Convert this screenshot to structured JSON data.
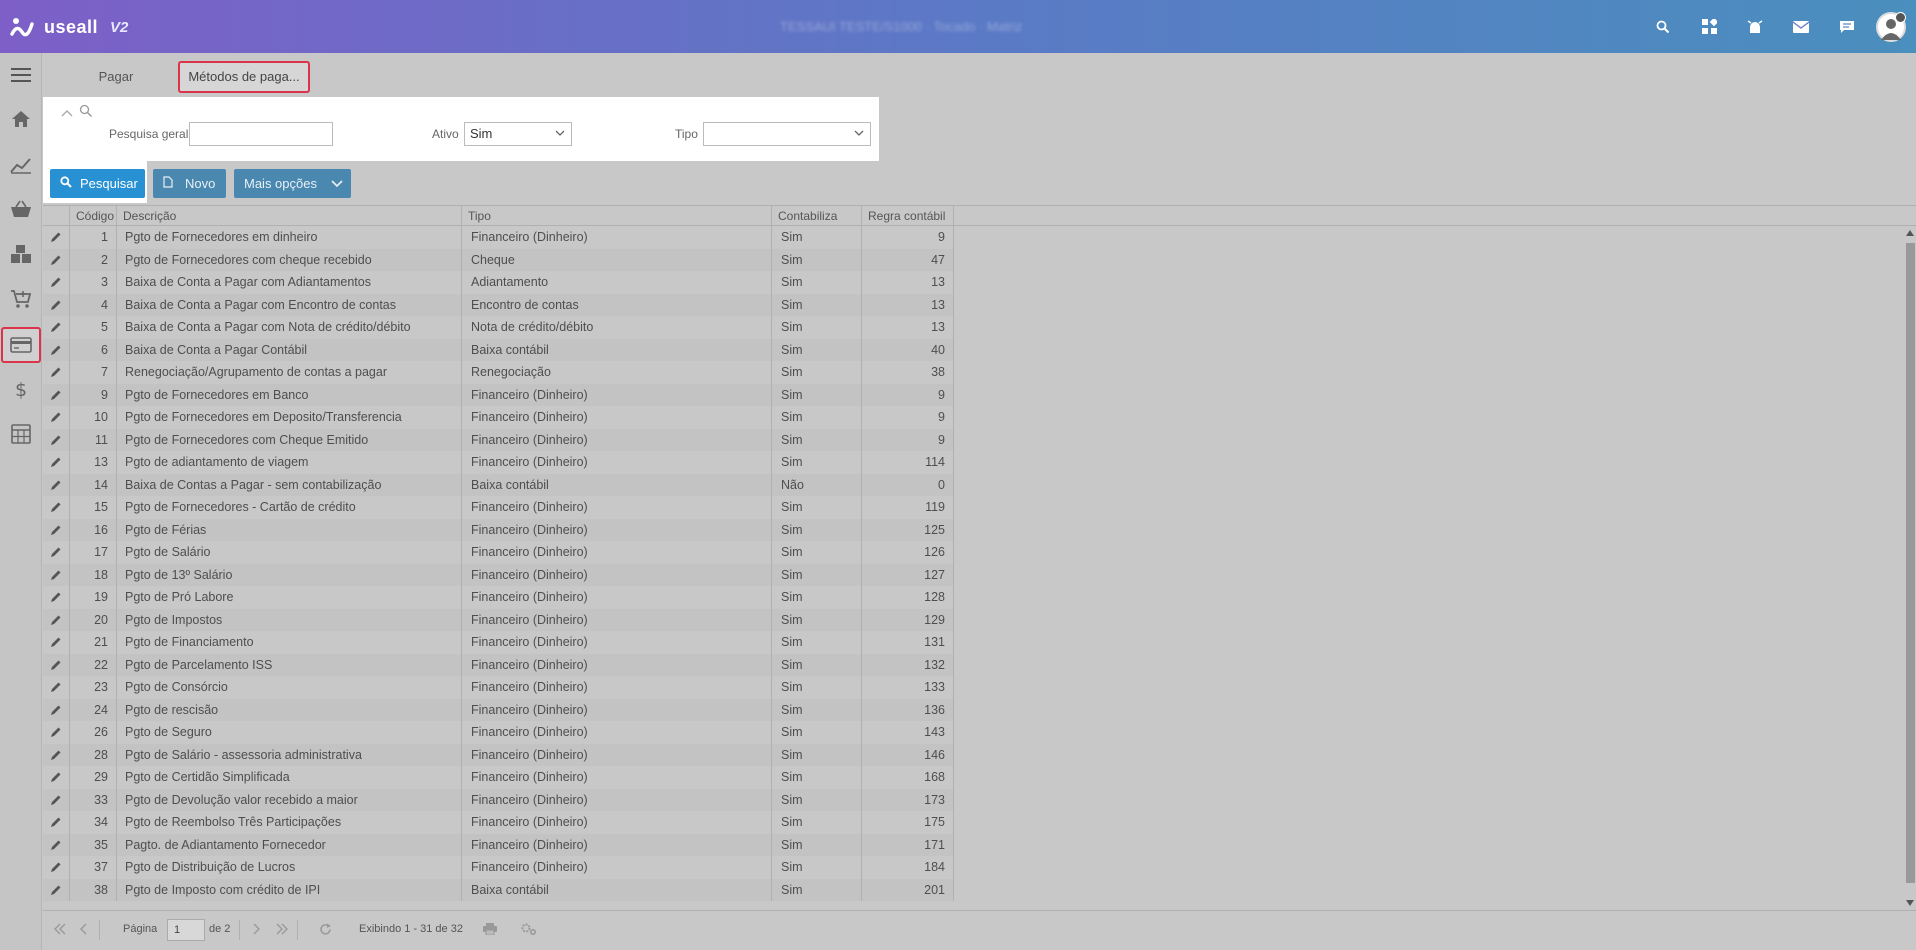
{
  "app": {
    "logo_text": "useall",
    "version": "V2",
    "center_text": "TESSAUI TESTE/S1000 · Tocado · Matriz"
  },
  "topbar_icons": [
    "search-icon",
    "apps-icon",
    "alarm-icon",
    "mail-icon",
    "chat-icon",
    "user-avatar"
  ],
  "sidebar_icons": [
    "menu-icon",
    "home-icon",
    "chart-icon",
    "basket-icon",
    "boxes-icon",
    "cart-icon",
    "payment-card-icon",
    "dollar-icon",
    "calculator-icon"
  ],
  "tabs": [
    {
      "label": "Pagar"
    },
    {
      "label": "Métodos de paga..."
    }
  ],
  "filter": {
    "general_label": "Pesquisa geral",
    "general_value": "",
    "ativo_label": "Ativo",
    "ativo_value": "Sim",
    "tipo_label": "Tipo",
    "tipo_value": ""
  },
  "actions": {
    "search_label": "Pesquisar",
    "new_label": "Novo",
    "more_label": "Mais opções"
  },
  "table": {
    "columns": [
      "Código",
      "Descrição",
      "Tipo",
      "Contabiliza",
      "Regra contábil"
    ],
    "rows": [
      {
        "code": "1",
        "desc": "Pgto de Fornecedores em dinheiro",
        "tipo": "Financeiro (Dinheiro)",
        "cont": "Sim",
        "regra": "9"
      },
      {
        "code": "2",
        "desc": "Pgto de Fornecedores com cheque recebido",
        "tipo": "Cheque",
        "cont": "Sim",
        "regra": "47"
      },
      {
        "code": "3",
        "desc": "Baixa de Conta a Pagar com Adiantamentos",
        "tipo": "Adiantamento",
        "cont": "Sim",
        "regra": "13"
      },
      {
        "code": "4",
        "desc": "Baixa de Conta a Pagar com Encontro de contas",
        "tipo": "Encontro de contas",
        "cont": "Sim",
        "regra": "13"
      },
      {
        "code": "5",
        "desc": "Baixa de Conta a Pagar com Nota de crédito/débito",
        "tipo": "Nota de crédito/débito",
        "cont": "Sim",
        "regra": "13"
      },
      {
        "code": "6",
        "desc": "Baixa de Conta a Pagar Contábil",
        "tipo": "Baixa contábil",
        "cont": "Sim",
        "regra": "40"
      },
      {
        "code": "7",
        "desc": "Renegociação/Agrupamento de contas a pagar",
        "tipo": "Renegociação",
        "cont": "Sim",
        "regra": "38"
      },
      {
        "code": "9",
        "desc": "Pgto de Fornecedores em Banco",
        "tipo": "Financeiro (Dinheiro)",
        "cont": "Sim",
        "regra": "9"
      },
      {
        "code": "10",
        "desc": "Pgto de Fornecedores em Deposito/Transferencia",
        "tipo": "Financeiro (Dinheiro)",
        "cont": "Sim",
        "regra": "9"
      },
      {
        "code": "11",
        "desc": "Pgto de Fornecedores com Cheque Emitido",
        "tipo": "Financeiro (Dinheiro)",
        "cont": "Sim",
        "regra": "9"
      },
      {
        "code": "13",
        "desc": "Pgto de adiantamento de viagem",
        "tipo": "Financeiro (Dinheiro)",
        "cont": "Sim",
        "regra": "114"
      },
      {
        "code": "14",
        "desc": "Baixa de Contas a Pagar - sem contabilização",
        "tipo": "Baixa contábil",
        "cont": "Não",
        "regra": "0"
      },
      {
        "code": "15",
        "desc": "Pgto de Fornecedores - Cartão de crédito",
        "tipo": "Financeiro (Dinheiro)",
        "cont": "Sim",
        "regra": "119"
      },
      {
        "code": "16",
        "desc": "Pgto de Férias",
        "tipo": "Financeiro (Dinheiro)",
        "cont": "Sim",
        "regra": "125"
      },
      {
        "code": "17",
        "desc": "Pgto de Salário",
        "tipo": "Financeiro (Dinheiro)",
        "cont": "Sim",
        "regra": "126"
      },
      {
        "code": "18",
        "desc": "Pgto de 13º Salário",
        "tipo": "Financeiro (Dinheiro)",
        "cont": "Sim",
        "regra": "127"
      },
      {
        "code": "19",
        "desc": "Pgto de Pró Labore",
        "tipo": "Financeiro (Dinheiro)",
        "cont": "Sim",
        "regra": "128"
      },
      {
        "code": "20",
        "desc": "Pgto de Impostos",
        "tipo": "Financeiro (Dinheiro)",
        "cont": "Sim",
        "regra": "129"
      },
      {
        "code": "21",
        "desc": "Pgto de Financiamento",
        "tipo": "Financeiro (Dinheiro)",
        "cont": "Sim",
        "regra": "131"
      },
      {
        "code": "22",
        "desc": "Pgto de Parcelamento ISS",
        "tipo": "Financeiro (Dinheiro)",
        "cont": "Sim",
        "regra": "132"
      },
      {
        "code": "23",
        "desc": "Pgto de Consórcio",
        "tipo": "Financeiro (Dinheiro)",
        "cont": "Sim",
        "regra": "133"
      },
      {
        "code": "24",
        "desc": "Pgto de rescisão",
        "tipo": "Financeiro (Dinheiro)",
        "cont": "Sim",
        "regra": "136"
      },
      {
        "code": "26",
        "desc": "Pgto de Seguro",
        "tipo": "Financeiro (Dinheiro)",
        "cont": "Sim",
        "regra": "143"
      },
      {
        "code": "28",
        "desc": "Pgto de Salário - assessoria administrativa",
        "tipo": "Financeiro (Dinheiro)",
        "cont": "Sim",
        "regra": "146"
      },
      {
        "code": "29",
        "desc": "Pgto de Certidão Simplificada",
        "tipo": "Financeiro (Dinheiro)",
        "cont": "Sim",
        "regra": "168"
      },
      {
        "code": "33",
        "desc": "Pgto de Devolução valor recebido a maior",
        "tipo": "Financeiro (Dinheiro)",
        "cont": "Sim",
        "regra": "173"
      },
      {
        "code": "34",
        "desc": "Pgto de Reembolso Três Participações",
        "tipo": "Financeiro (Dinheiro)",
        "cont": "Sim",
        "regra": "175"
      },
      {
        "code": "35",
        "desc": "Pagto. de Adiantamento Fornecedor",
        "tipo": "Financeiro (Dinheiro)",
        "cont": "Sim",
        "regra": "171"
      },
      {
        "code": "37",
        "desc": "Pgto de Distribuição de Lucros",
        "tipo": "Financeiro (Dinheiro)",
        "cont": "Sim",
        "regra": "184"
      },
      {
        "code": "38",
        "desc": "Pgto de Imposto com crédito de IPI",
        "tipo": "Baixa contábil",
        "cont": "Sim",
        "regra": "201"
      }
    ]
  },
  "pager": {
    "page_label": "Página",
    "page_value": "1",
    "of_label": "de 2",
    "summary": "Exibindo 1 - 31 de 32"
  },
  "colors": {
    "accent": "#2791d3",
    "highlight_border": "#d9344a",
    "topbar_start": "#7d5fc7",
    "topbar_end": "#4a8fbe"
  }
}
